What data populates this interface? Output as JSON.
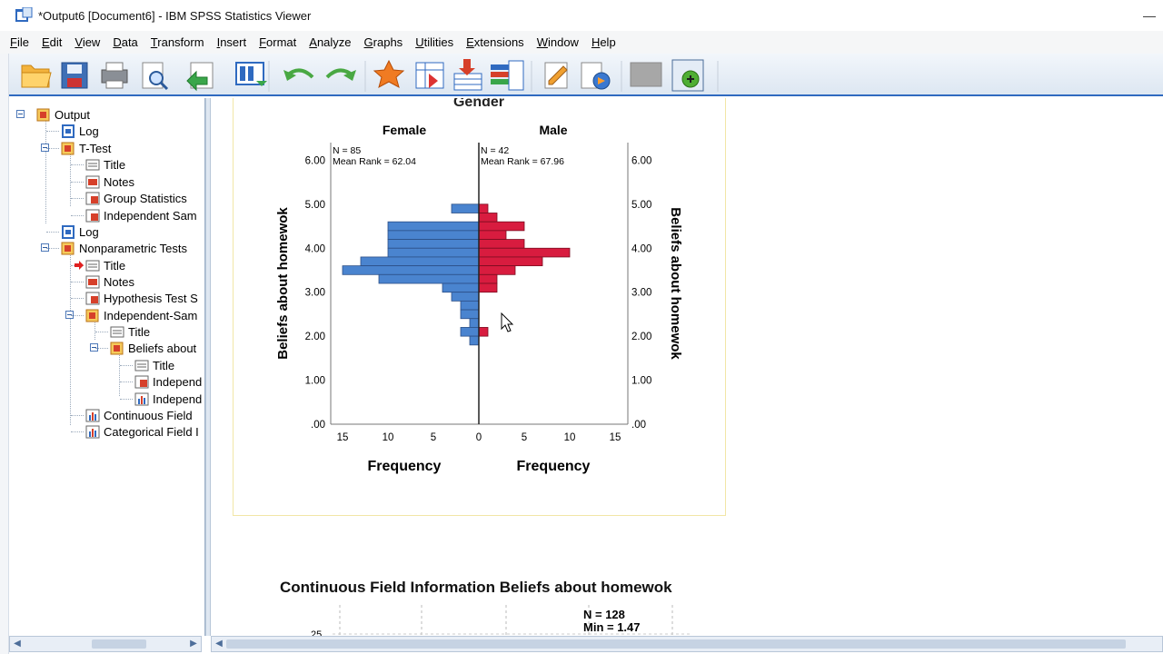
{
  "window": {
    "title": "*Output6 [Document6] - IBM SPSS Statistics Viewer",
    "minimize_glyph": "—"
  },
  "menu": [
    {
      "first": "F",
      "rest": "ile"
    },
    {
      "first": "E",
      "rest": "dit"
    },
    {
      "first": "V",
      "rest": "iew"
    },
    {
      "first": "D",
      "rest": "ata"
    },
    {
      "first": "T",
      "rest": "ransform"
    },
    {
      "first": "I",
      "rest": "nsert"
    },
    {
      "first": "F",
      "rest": "ormat"
    },
    {
      "first": "A",
      "rest": "nalyze"
    },
    {
      "first": "G",
      "rest": "raphs"
    },
    {
      "first": "U",
      "rest": "tilities"
    },
    {
      "first": "E",
      "rest": "xtensions"
    },
    {
      "first": "W",
      "rest": "indow"
    },
    {
      "first": "H",
      "rest": "elp"
    }
  ],
  "toolbar": {
    "icons": [
      "open-folder-icon",
      "save-icon",
      "print-icon",
      "print-preview-icon",
      "export-icon",
      "goto-data-icon",
      "undo-icon",
      "redo-icon",
      "goto-case-icon",
      "goto-variable-icon",
      "insert-cases-icon",
      "variables-icon",
      "designate-window-icon",
      "create-title-icon",
      "disabled-icon",
      "add-icon"
    ]
  },
  "outline": {
    "items": [
      {
        "label": "Output",
        "icon": "output-book-icon"
      },
      {
        "label": "Log",
        "icon": "log-icon"
      },
      {
        "label": "T-Test",
        "icon": "procedure-book-icon"
      },
      {
        "label": "Title",
        "icon": "title-icon"
      },
      {
        "label": "Notes",
        "icon": "notes-icon"
      },
      {
        "label": "Group Statistics",
        "icon": "table-icon"
      },
      {
        "label": "Independent Sam",
        "icon": "table-icon"
      },
      {
        "label": "Log",
        "icon": "log-icon"
      },
      {
        "label": "Nonparametric Tests",
        "icon": "procedure-book-icon"
      },
      {
        "label": "Title",
        "icon": "title-icon"
      },
      {
        "label": "Notes",
        "icon": "notes-icon"
      },
      {
        "label": "Hypothesis Test S",
        "icon": "table-icon"
      },
      {
        "label": "Independent-Sam",
        "icon": "procedure-book-icon"
      },
      {
        "label": "Title",
        "icon": "title-icon"
      },
      {
        "label": "Beliefs about",
        "icon": "procedure-book-icon"
      },
      {
        "label": "Title",
        "icon": "title-icon"
      },
      {
        "label": "Independ",
        "icon": "table-icon"
      },
      {
        "label": "Independ",
        "icon": "chart-icon"
      },
      {
        "label": "Continuous Field",
        "icon": "chart-icon"
      },
      {
        "label": "Categorical Field I",
        "icon": "chart-icon"
      }
    ]
  },
  "chart_data": {
    "type": "bar",
    "orientation": "horizontal-population-pyramid",
    "title": "Gender",
    "panels": [
      {
        "name": "Female",
        "n_label": "N = 85",
        "rank_label": "Mean Rank = 62.04",
        "color": "#4a84cf"
      },
      {
        "name": "Male",
        "n_label": "N = 42",
        "rank_label": "Mean Rank = 67.96",
        "color": "#d81c3f"
      }
    ],
    "ylabel": "Beliefs about homewok",
    "xlabel_left": "Frequency",
    "xlabel_right": "Frequency",
    "y_ticks": [
      "6.00",
      "5.00",
      "4.00",
      "3.00",
      "2.00",
      "1.00",
      ".00"
    ],
    "x_ticks_left": [
      "15",
      "10",
      "5",
      "0"
    ],
    "x_ticks_right": [
      "5",
      "10",
      "15"
    ],
    "ylim": [
      0,
      6.4
    ],
    "xlim": [
      0,
      16
    ],
    "bin_width": 0.2,
    "bins": [
      4.8,
      4.6,
      4.4,
      4.2,
      4.0,
      3.8,
      3.6,
      3.4,
      3.2,
      3.0,
      2.8,
      2.6,
      2.4,
      2.2,
      2.0,
      1.8,
      1.6,
      1.4,
      1.2
    ],
    "series": [
      {
        "name": "Female",
        "values": [
          3,
          0,
          10,
          10,
          10,
          10,
          13,
          15,
          11,
          4,
          3,
          2,
          2,
          1,
          2,
          1,
          0,
          0,
          0
        ]
      },
      {
        "name": "Male",
        "values": [
          1,
          2,
          5,
          3,
          5,
          10,
          7,
          4,
          2,
          2,
          0,
          0,
          0,
          0,
          1,
          0,
          0,
          0,
          0
        ]
      }
    ]
  },
  "continuous_field": {
    "title": "Continuous Field Information Beliefs about homewok",
    "n_label": "N = 128",
    "min_label": "Min = 1.47",
    "axis_tick": "25"
  }
}
